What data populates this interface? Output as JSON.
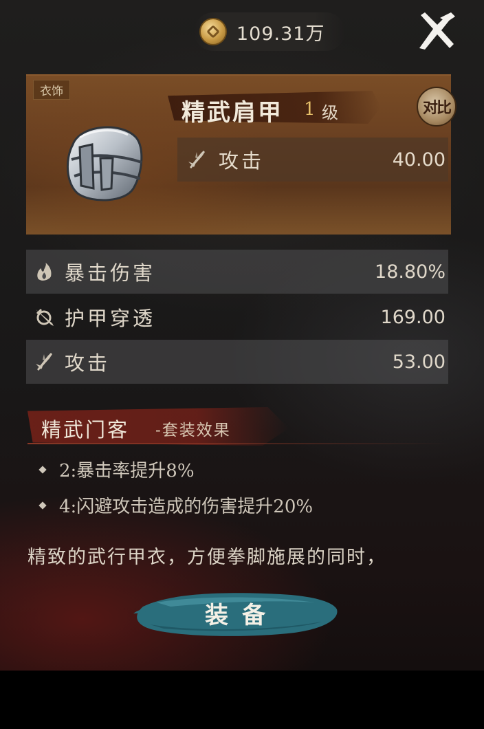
{
  "currency": {
    "icon": "coin-icon",
    "amount": "109.31万"
  },
  "close": {
    "icon": "close-icon"
  },
  "item": {
    "category": "衣饰",
    "name": "精武肩甲",
    "level": "1",
    "level_unit": "级",
    "icon": "shoulder-armor-icon",
    "compare_label": "对比",
    "main_stat": {
      "icon": "sword-icon",
      "label": "攻击",
      "value": "40.00"
    }
  },
  "sub_stats": [
    {
      "icon": "flame-icon",
      "label": "暴击伤害",
      "value": "18.80%"
    },
    {
      "icon": "pierce-icon",
      "label": "护甲穿透",
      "value": "169.00"
    },
    {
      "icon": "sword-icon",
      "label": "攻击",
      "value": "53.00"
    }
  ],
  "set": {
    "name": "精武门客",
    "subtitle": "-套装效果",
    "bonuses": [
      "2:暴击率提升8%",
      "4:闪避攻击造成的伤害提升20%"
    ]
  },
  "description": "精致的武行甲衣，方便拳脚施展的同时，",
  "equip_button": {
    "label": "装备"
  },
  "colors": {
    "accent_gold": "#e6c06a",
    "card_brown": "#6a4021",
    "set_red": "#6e2018",
    "button_teal": "#2e7a86"
  }
}
